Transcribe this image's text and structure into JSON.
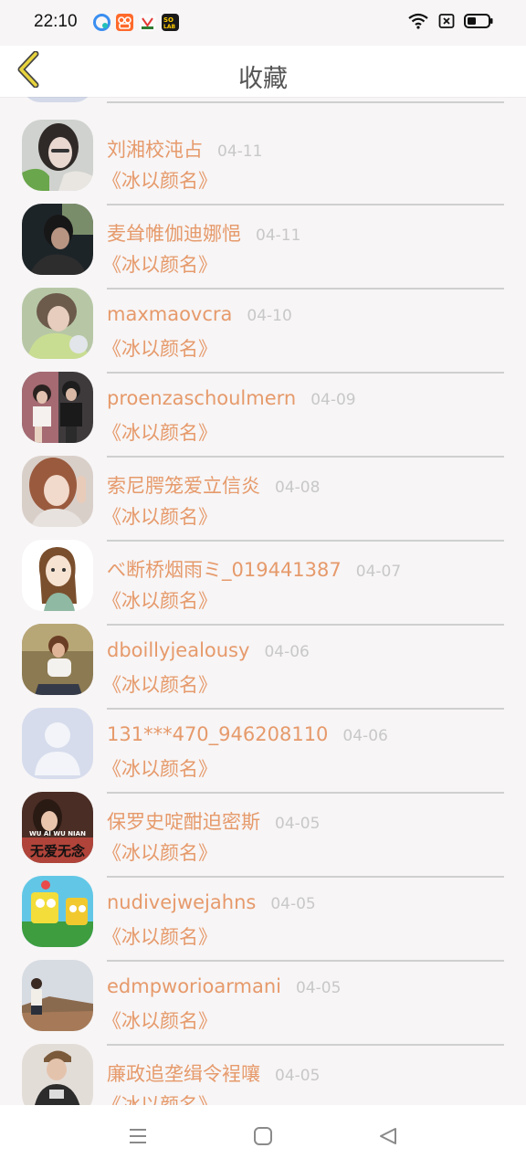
{
  "status_bar": {
    "time": "22:10",
    "notification_icons": [
      {
        "name": "browser-app-icon",
        "color": "#3a8ef0"
      },
      {
        "name": "kuaishou-app-icon",
        "color": "#ff6a2a"
      },
      {
        "name": "taobao-app-icon",
        "color": "#f5f5f5"
      },
      {
        "name": "soul-app-icon",
        "color": "#1a1a1a"
      }
    ]
  },
  "header": {
    "title": "收藏",
    "back_icon": "chevron-left-icon",
    "accent": "#e7d33d"
  },
  "colors": {
    "username": "#e69a6b",
    "date": "#c8c8c8",
    "divider": "#cfcfcf"
  },
  "items": [
    {
      "username": "刘湘校沌占",
      "date": "04-11",
      "book": "《冰以颜名》",
      "avatar": "avatar-girl-glasses"
    },
    {
      "username": "麦耸帷伽迪娜悒",
      "date": "04-11",
      "book": "《冰以颜名》",
      "avatar": "avatar-boy-dark"
    },
    {
      "username": "maxmaovcra",
      "date": "04-10",
      "book": "《冰以颜名》",
      "avatar": "avatar-girl-green"
    },
    {
      "username": "proenzaschoulmern",
      "date": "04-09",
      "book": "《冰以颜名》",
      "avatar": "avatar-couple"
    },
    {
      "username": "索尼腭笼爱立信炎",
      "date": "04-08",
      "book": "《冰以颜名》",
      "avatar": "avatar-girl-brown-hair"
    },
    {
      "username": "べ断桥烟雨ミ_019441387",
      "date": "04-07",
      "book": "《冰以颜名》",
      "avatar": "avatar-anime-girl"
    },
    {
      "username": "dboillyjealousy",
      "date": "04-06",
      "book": "《冰以颜名》",
      "avatar": "avatar-boy-sitting"
    },
    {
      "username": "131***470_946208110",
      "date": "04-06",
      "book": "《冰以颜名》",
      "avatar": "avatar-default"
    },
    {
      "username": "保罗史啶酣迫密斯",
      "date": "04-05",
      "book": "《冰以颜名》",
      "avatar": "avatar-wuainian",
      "avatar_text_top": "WU  AI  WU  NIAN",
      "avatar_text": "无爱无念"
    },
    {
      "username": "nudivejwejahns",
      "date": "04-05",
      "book": "《冰以颜名》",
      "avatar": "avatar-cartoon"
    },
    {
      "username": "edmpworioarmani",
      "date": "04-05",
      "book": "《冰以颜名》",
      "avatar": "avatar-landscape"
    },
    {
      "username": "廉政追垄缉令裎嚷",
      "date": "04-05",
      "book": "《冰以颜名》",
      "avatar": "avatar-boy-cap"
    }
  ],
  "nav_bar": {
    "menu_icon": "menu-icon",
    "home_icon": "home-icon",
    "back_icon": "back-triangle-icon"
  }
}
